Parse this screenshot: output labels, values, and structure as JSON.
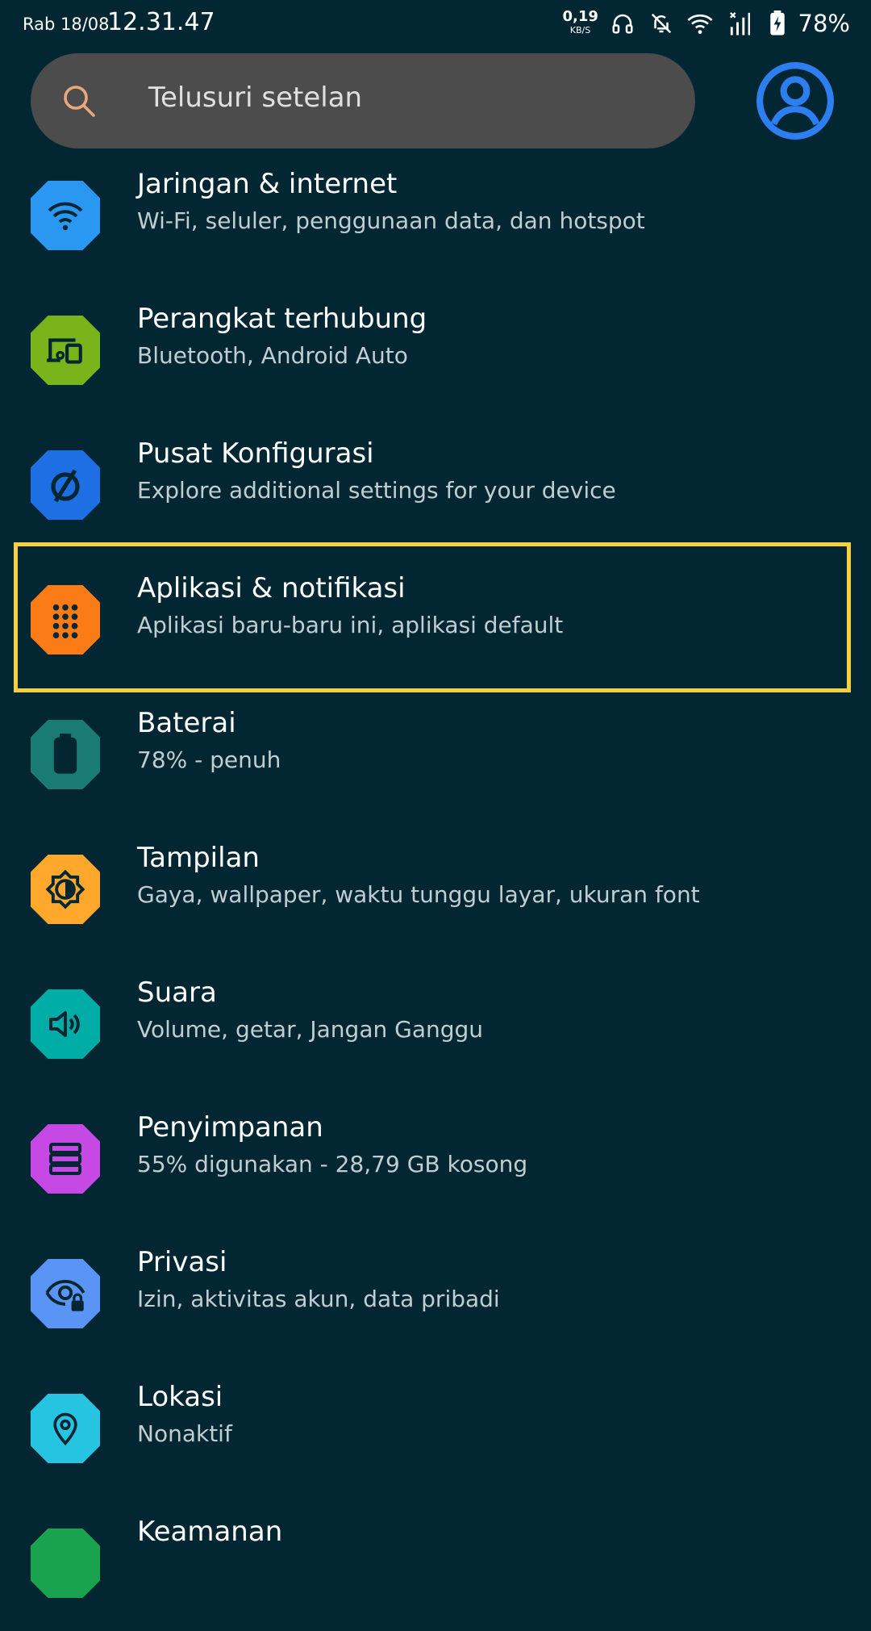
{
  "status_bar": {
    "date": "Rab 18/08",
    "time": "12.31.47",
    "net_speed_value": "0,19",
    "net_speed_unit": "KB/S",
    "battery_percent": "78%"
  },
  "search": {
    "placeholder": "Telusuri setelan"
  },
  "colors": {
    "background": "#022733",
    "highlight": "#f7cf3f",
    "search_bg": "#4c4c4c"
  },
  "settings": [
    {
      "title": "Jaringan & internet",
      "subtitle": "Wi-Fi, seluler, penggunaan data, dan hotspot",
      "icon": "wifi-icon",
      "color": "#2a98f2"
    },
    {
      "title": "Perangkat terhubung",
      "subtitle": "Bluetooth, Android Auto",
      "icon": "devices-icon",
      "color": "#79b51a"
    },
    {
      "title": "Pusat Konfigurasi",
      "subtitle": "Explore additional settings for your device",
      "icon": "slashed-circle-icon",
      "color": "#1e6fe3"
    },
    {
      "title": "Aplikasi & notifikasi",
      "subtitle": "Aplikasi baru-baru ini, aplikasi default",
      "icon": "apps-grid-icon",
      "color": "#fb7b16"
    },
    {
      "title": "Baterai",
      "subtitle": "78% - penuh",
      "icon": "battery-icon",
      "color": "#1a7b74"
    },
    {
      "title": "Tampilan",
      "subtitle": "Gaya, wallpaper, waktu tunggu layar, ukuran font",
      "icon": "brightness-icon",
      "color": "#ffa82c"
    },
    {
      "title": "Suara",
      "subtitle": "Volume, getar, Jangan Ganggu",
      "icon": "speaker-icon",
      "color": "#00aca6"
    },
    {
      "title": "Penyimpanan",
      "subtitle": "55% digunakan - 28,79 GB kosong",
      "icon": "storage-icon",
      "color": "#c649e6"
    },
    {
      "title": "Privasi",
      "subtitle": "Izin, aktivitas akun, data pribadi",
      "icon": "privacy-eye-icon",
      "color": "#5a95f5"
    },
    {
      "title": "Lokasi",
      "subtitle": "Nonaktif",
      "icon": "location-pin-icon",
      "color": "#27c4e1"
    },
    {
      "title": "Keamanan",
      "subtitle": "",
      "icon": "security-icon",
      "color": "#1aa34f"
    }
  ]
}
